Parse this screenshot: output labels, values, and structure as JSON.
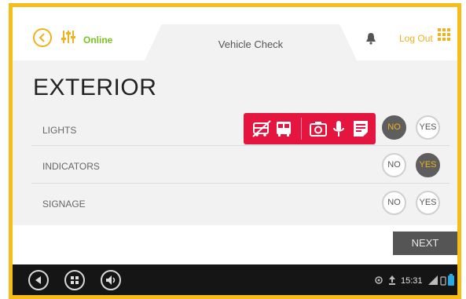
{
  "header": {
    "status": "Online",
    "tab_title": "Vehicle Check",
    "logout_label": "Log Out"
  },
  "colors": {
    "accent": "#f0b21d",
    "online": "#7ac41e",
    "toolbar_red": "#e4163f",
    "active_toggle": "#5e5e5e"
  },
  "section": {
    "title": "EXTERIOR"
  },
  "items": [
    {
      "label": "LIGHTS",
      "no": "NO",
      "yes": "YES",
      "selected": "NO"
    },
    {
      "label": "INDICATORS",
      "no": "NO",
      "yes": "YES",
      "selected": "YES"
    },
    {
      "label": "SIGNAGE",
      "no": "NO",
      "yes": "YES",
      "selected": ""
    }
  ],
  "toolbar": {
    "icons": [
      "no-bus-icon",
      "bus-icon",
      "camera-icon",
      "microphone-icon",
      "notes-icon"
    ]
  },
  "actions": {
    "next_label": "NEXT"
  },
  "system_bar": {
    "buttons": [
      "back-nav-icon",
      "home-nav-icon",
      "volume-icon"
    ],
    "time": "15:31"
  }
}
